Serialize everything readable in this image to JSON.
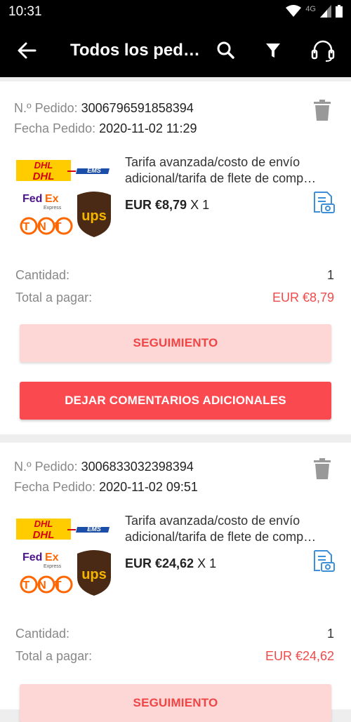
{
  "status_bar": {
    "time": "10:31",
    "network": "4G"
  },
  "app_bar": {
    "title": "Todos los ped…"
  },
  "orders": [
    {
      "order_label": "N.º Pedido:",
      "order_number": "3006796591858394",
      "date_label": "Fecha Pedido:",
      "date_value": "2020-11-02 11:29",
      "product_title_line1": "Tarifa avanzada/costo de envío",
      "product_title_line2": "adicional/tarifa de flete de comp…",
      "price": "EUR €8,79",
      "qty_suffix": "X 1",
      "quantity_label": "Cantidad:",
      "quantity_value": "1",
      "total_label": "Total a pagar:",
      "total_value": "EUR €8,79",
      "track_button": "SEGUIMIENTO",
      "review_button": "DEJAR COMENTARIOS ADICIONALES"
    },
    {
      "order_label": "N.º Pedido:",
      "order_number": "3006833032398394",
      "date_label": "Fecha Pedido:",
      "date_value": "2020-11-02 09:51",
      "product_title_line1": "Tarifa avanzada/costo de envío",
      "product_title_line2": "adicional/tarifa de flete de comp…",
      "price": "EUR €24,62",
      "qty_suffix": "X 1",
      "quantity_label": "Cantidad:",
      "quantity_value": "1",
      "total_label": "Total a pagar:",
      "total_value": "EUR €24,62",
      "track_button": "SEGUIMIENTO"
    }
  ],
  "logos": {
    "dhl": "DHL",
    "ems": "EMS",
    "fedex_fed": "Fed",
    "fedex_ex": "Ex",
    "fedex_express": "Express",
    "tnt": "TNT",
    "ups": "ups"
  },
  "colors": {
    "accent": "#fb4a4f",
    "accent_light": "#fdd6d6",
    "total_red": "#f04a4a",
    "icon_blue": "#3d8fd8"
  }
}
